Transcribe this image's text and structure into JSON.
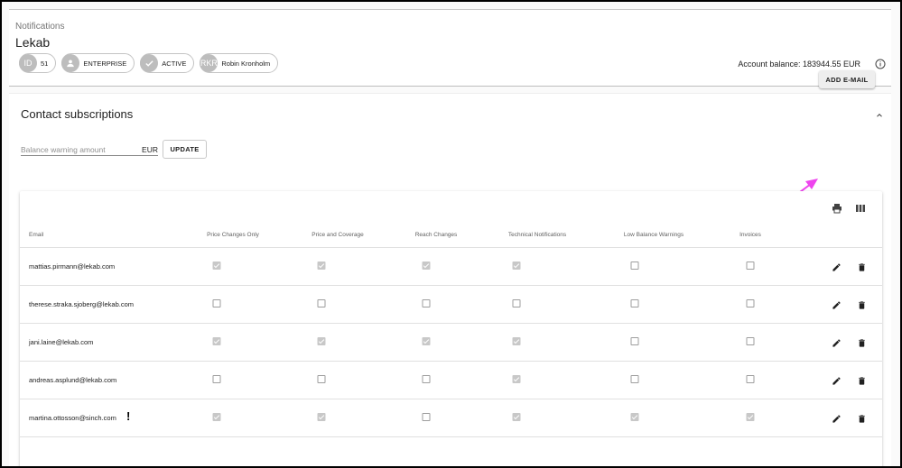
{
  "header": {
    "breadcrumb": "Notifications",
    "account_name": "Lekab",
    "chips": [
      {
        "avatar": "ID",
        "label": "51"
      },
      {
        "avatar": "person-icon",
        "label": "ENTERPRISE"
      },
      {
        "avatar": "check-icon",
        "label": "ACTIVE"
      },
      {
        "avatar": "RKR",
        "label": "Robin Kronholm"
      }
    ],
    "balance": "Account balance: 183944.55 EUR"
  },
  "panel": {
    "title": "Contact subscriptions",
    "balance_placeholder": "Balance warning amount",
    "currency": "EUR",
    "update_label": "UPDATE",
    "add_email_label": "ADD E-MAIL"
  },
  "table": {
    "columns": [
      "Email",
      "Price Changes Only",
      "Price and Coverage",
      "Reach Changes",
      "Technical Notifications",
      "Low Balance Warnings",
      "Invoices"
    ],
    "rows": [
      {
        "email": "mattias.pirmann@lekab.com",
        "checks": [
          true,
          true,
          true,
          true,
          false,
          false
        ]
      },
      {
        "email": "therese.straka.sjoberg@lekab.com",
        "checks": [
          false,
          false,
          false,
          false,
          false,
          false
        ]
      },
      {
        "email": "jani.laine@lekab.com",
        "checks": [
          true,
          true,
          true,
          true,
          false,
          false
        ]
      },
      {
        "email": "andreas.asplund@lekab.com",
        "checks": [
          false,
          false,
          false,
          true,
          false,
          false
        ]
      },
      {
        "email": "martina.ottosson@sinch.com",
        "checks": [
          true,
          true,
          false,
          true,
          true,
          true
        ],
        "mark": "!"
      }
    ]
  },
  "colors": {
    "annotation_arrow": "#ee44ee",
    "checked_box": "#c8c8c8"
  }
}
